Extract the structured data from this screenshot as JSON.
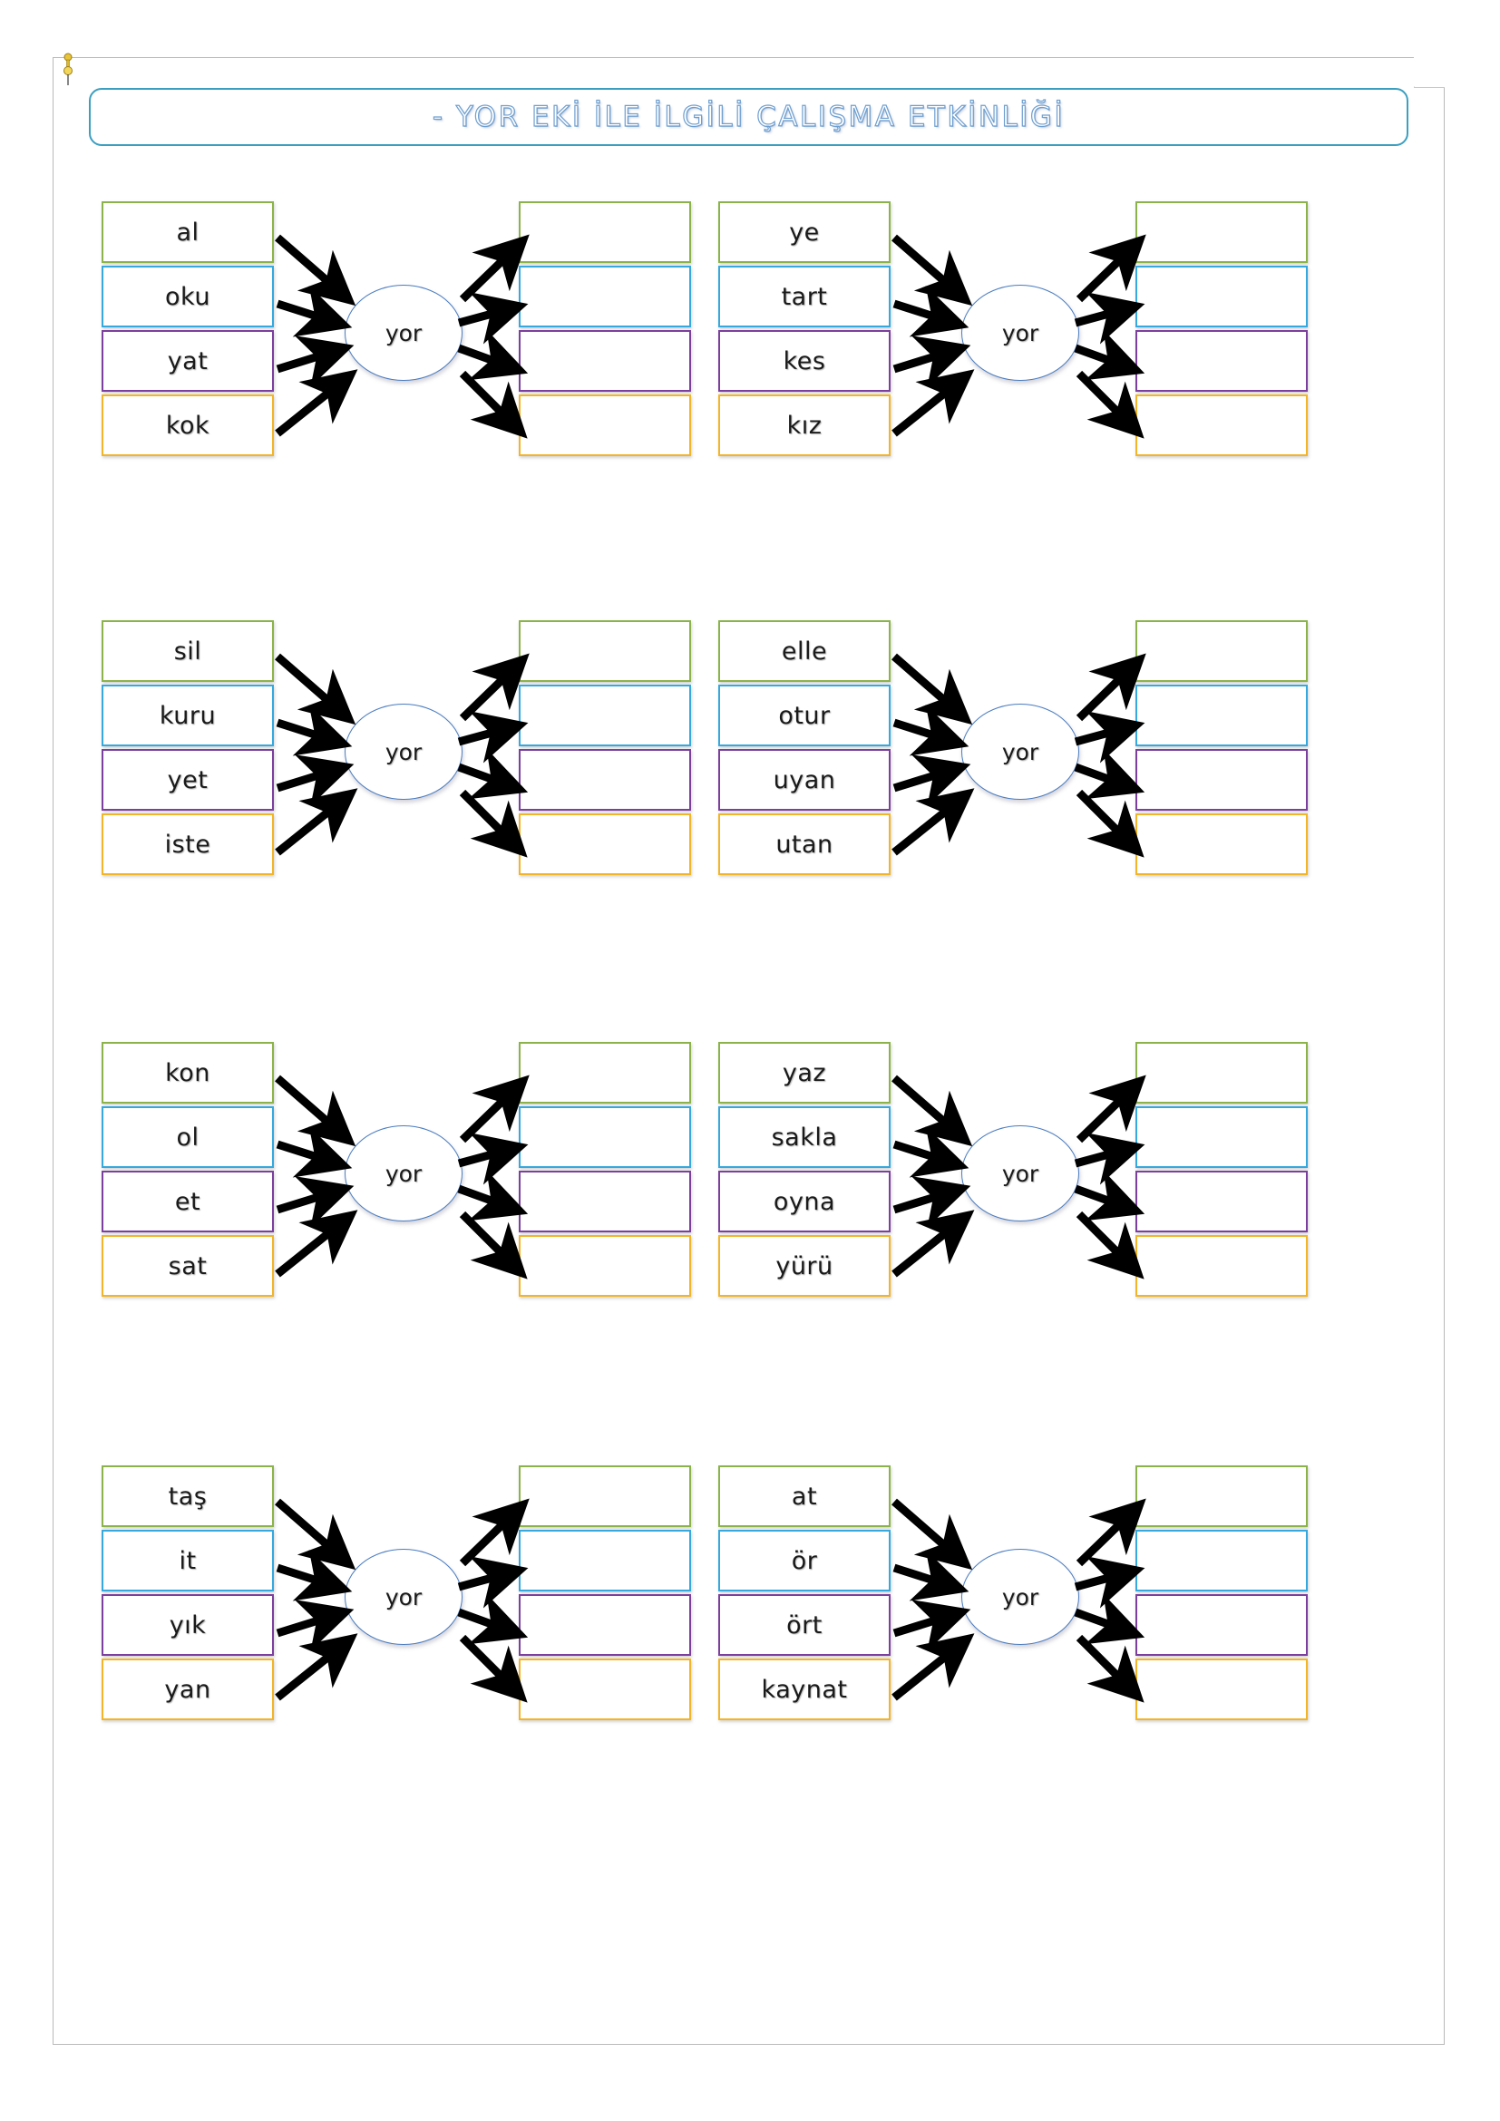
{
  "document": {
    "title": "-  YOR EKİ İLE İLGİLİ ÇALIŞMA ETKİNLİĞİ",
    "suffix_label": "yor"
  },
  "colors": {
    "title_border": "#3c9fc0",
    "title_text_outline": "#6f9fd0",
    "ellipse_border": "#4a7cc0",
    "row_green": "#8bb34a",
    "row_blue": "#35a8dd",
    "row_purple": "#7b3f9d",
    "row_orange": "#f2b429",
    "page_border": "#b9b9b9",
    "arrow": "#000000"
  },
  "exercises": [
    {
      "id": 1,
      "suffix": "yor",
      "stems": [
        "al",
        "oku",
        "yat",
        "kok"
      ],
      "answers": [
        "",
        "",
        "",
        ""
      ]
    },
    {
      "id": 2,
      "suffix": "yor",
      "stems": [
        "ye",
        "tart",
        "kes",
        "kız"
      ],
      "answers": [
        "",
        "",
        "",
        ""
      ]
    },
    {
      "id": 3,
      "suffix": "yor",
      "stems": [
        "sil",
        "kuru",
        "yet",
        "iste"
      ],
      "answers": [
        "",
        "",
        "",
        ""
      ]
    },
    {
      "id": 4,
      "suffix": "yor",
      "stems": [
        "elle",
        "otur",
        "uyan",
        "utan"
      ],
      "answers": [
        "",
        "",
        "",
        ""
      ]
    },
    {
      "id": 5,
      "suffix": "yor",
      "stems": [
        "kon",
        "ol",
        "et",
        "sat"
      ],
      "answers": [
        "",
        "",
        "",
        ""
      ]
    },
    {
      "id": 6,
      "suffix": "yor",
      "stems": [
        "yaz",
        "sakla",
        "oyna",
        "yürü"
      ],
      "answers": [
        "",
        "",
        "",
        ""
      ]
    },
    {
      "id": 7,
      "suffix": "yor",
      "stems": [
        "taş",
        "it",
        "yık",
        "yan"
      ],
      "answers": [
        "",
        "",
        "",
        ""
      ]
    },
    {
      "id": 8,
      "suffix": "yor",
      "stems": [
        "at",
        "ör",
        "ört",
        "kaynat"
      ],
      "answers": [
        "",
        "",
        "",
        ""
      ]
    }
  ]
}
